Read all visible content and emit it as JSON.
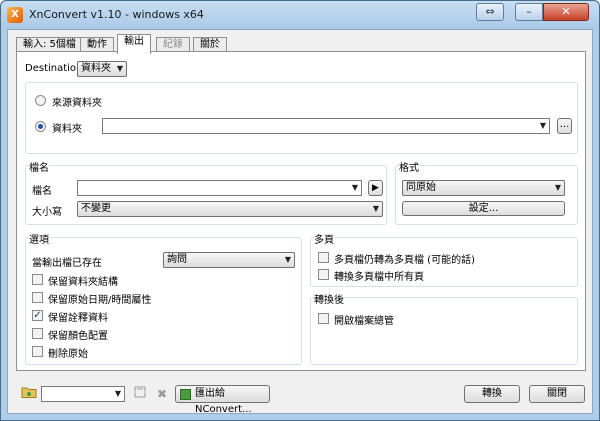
{
  "window": {
    "title": "XnConvert v1.10 - windows x64",
    "icon_glyph": "X",
    "restore_glyph": "⇔",
    "min_glyph": "–",
    "close_glyph": "✕"
  },
  "tabs": [
    {
      "label": "輸入: 5個檔",
      "state": "normal"
    },
    {
      "label": "動作",
      "state": "normal"
    },
    {
      "label": "輸出",
      "state": "active"
    },
    {
      "label": "紀錄",
      "state": "disabled"
    },
    {
      "label": "關於",
      "state": "normal"
    }
  ],
  "destination": {
    "label": "Destination:",
    "value": "資料夾",
    "radio_source": "來源資料夾",
    "radio_folder": "資料夾",
    "folder_path": "",
    "browse_label": "..."
  },
  "filename": {
    "group_title": "檔名",
    "name_label": "檔名",
    "name_value": "",
    "case_label": "大小寫",
    "case_value": "不變更",
    "play_glyph": "▶"
  },
  "format": {
    "group_title": "格式",
    "value": "同原始",
    "settings_label": "設定..."
  },
  "options": {
    "group_title": "選項",
    "exists_label": "當輸出檔已存在",
    "exists_value": "詢問",
    "items": [
      {
        "label": "保留資料夾結構",
        "checked": false
      },
      {
        "label": "保留原始日期/時間屬性",
        "checked": false
      },
      {
        "label": "保留詮釋資料",
        "checked": true
      },
      {
        "label": "保留顏色配置",
        "checked": false
      },
      {
        "label": "刪除原始",
        "checked": false
      }
    ]
  },
  "multipage": {
    "group_title": "多頁",
    "items": [
      {
        "label": "多頁檔仍轉為多頁檔 (可能的話)",
        "checked": false
      },
      {
        "label": "轉換多頁檔中所有頁",
        "checked": false
      }
    ]
  },
  "after": {
    "group_title": "轉換後",
    "items": [
      {
        "label": "開啟檔案總管",
        "checked": false
      }
    ]
  },
  "bottom": {
    "preset_value": "",
    "export_label": "匯出給NConvert...",
    "convert_label": "轉換",
    "close_label": "關閉"
  },
  "colors": {
    "frame": "#aecde9",
    "panel": "#ffffff",
    "client": "#f0f0f0",
    "accent": "#2255a0"
  }
}
